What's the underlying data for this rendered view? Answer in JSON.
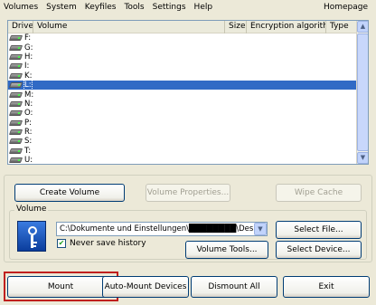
{
  "menu": [
    {
      "label": "Volumes",
      "name": "menu-volumes"
    },
    {
      "label": "System",
      "name": "menu-system"
    },
    {
      "label": "Keyfiles",
      "name": "menu-keyfiles"
    },
    {
      "label": "Tools",
      "name": "menu-tools"
    },
    {
      "label": "Settings",
      "name": "menu-settings"
    },
    {
      "label": "Help",
      "name": "menu-help"
    }
  ],
  "homepage": "Homepage",
  "list": {
    "headers": {
      "drive": "Drive",
      "volume": "Volume",
      "size": "Size",
      "algorithm": "Encryption algorithm",
      "type": "Type"
    },
    "drives": [
      "F:",
      "G:",
      "H:",
      "I:",
      "K:",
      "L:",
      "M:",
      "N:",
      "O:",
      "P:",
      "R:",
      "S:",
      "T:",
      "U:"
    ],
    "selected_index": 5
  },
  "buttons": {
    "create_volume": "Create Volume",
    "volume_properties": "Volume Properties...",
    "wipe_cache": "Wipe Cache",
    "select_file": "Select File...",
    "volume_tools": "Volume Tools...",
    "select_device": "Select Device...",
    "mount": "Mount",
    "auto_mount": "Auto-Mount Devices",
    "dismount_all": "Dismount All",
    "exit": "Exit"
  },
  "volume_group": {
    "label": "Volume",
    "path": "C:\\Dokumente und Einstellungen\\████████\\Desktop\\Contair",
    "never_save_history": "Never save history",
    "never_save_checked": true
  },
  "colors": {
    "selection": "#316ac5",
    "highlight_border": "#c0201e",
    "window_bg": "#ece9d8"
  }
}
